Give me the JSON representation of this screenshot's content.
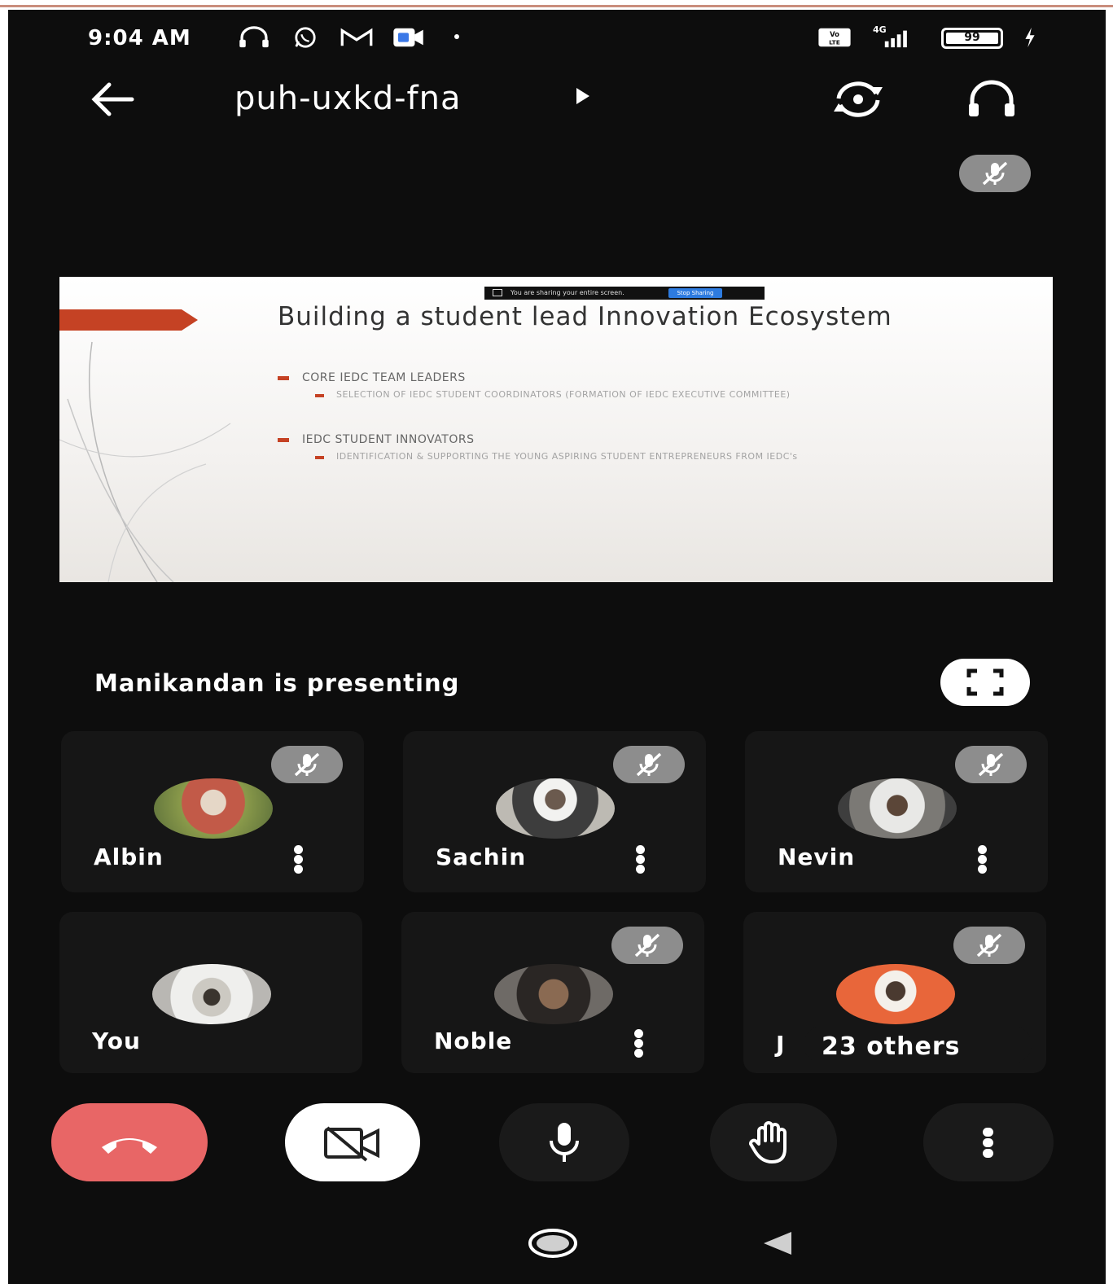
{
  "status_bar": {
    "time": "9:04 AM",
    "network": "4G",
    "battery": "99"
  },
  "header": {
    "meeting_code": "puh-uxkd-fna"
  },
  "slide": {
    "share_bar_text": "You are sharing your entire screen.",
    "share_bar_button": "Stop Sharing",
    "title": "Building a student lead Innovation Ecosystem",
    "bullets": [
      {
        "text": "CORE IEDC TEAM LEADERS",
        "sub": "SELECTION OF IEDC STUDENT   COORDINATORS (FORMATION OF IEDC EXECUTIVE COMMITTEE)"
      },
      {
        "text": "IEDC STUDENT INNOVATORS",
        "sub": "IDENTIFICATION & SUPPORTING THE YOUNG ASPIRING STUDENT ENTREPRENEURS FROM IEDC's"
      }
    ]
  },
  "presenting_label": "Manikandan is presenting",
  "participants": [
    {
      "name": "Albin",
      "muted": true,
      "avatar_color": "#c25a48"
    },
    {
      "name": "Sachin",
      "muted": true,
      "avatar_color": "#b7b4ae"
    },
    {
      "name": "Nevin",
      "muted": true,
      "avatar_color": "#7a7875"
    },
    {
      "name": "You",
      "muted": false,
      "avatar_color": "#cfcfcb"
    },
    {
      "name": "Noble",
      "muted": true,
      "avatar_color": "#3a3633"
    },
    {
      "name": "J",
      "muted": true,
      "avatar_color": "#e8663a",
      "others_label": "23 others"
    }
  ],
  "colors": {
    "end_call": "#e86666",
    "mute_badge": "#8d8d8d",
    "background": "#0d0d0d"
  }
}
